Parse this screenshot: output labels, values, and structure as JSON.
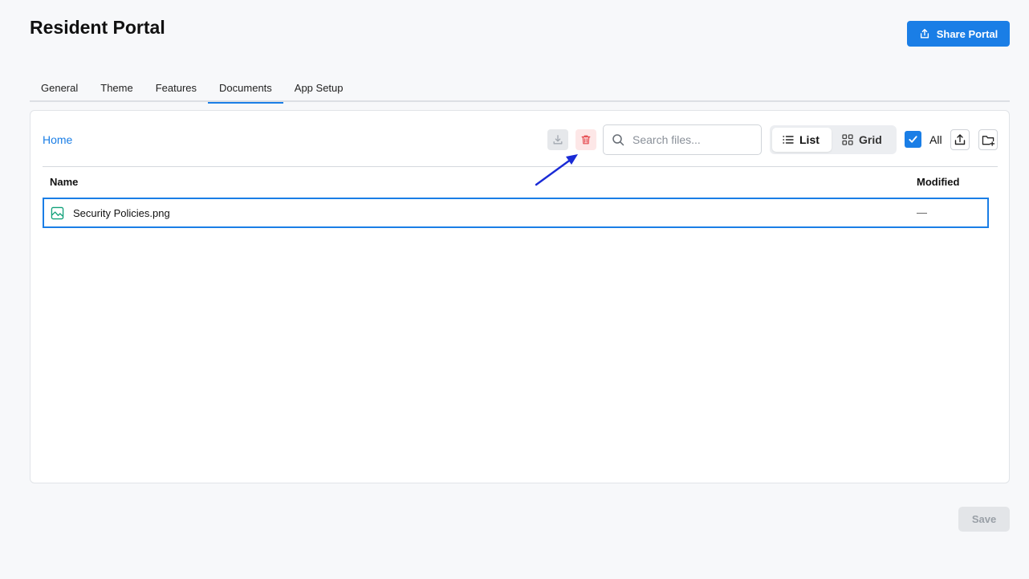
{
  "header": {
    "title": "Resident Portal",
    "share_label": "Share Portal"
  },
  "tabs": [
    {
      "label": "General",
      "active": false
    },
    {
      "label": "Theme",
      "active": false
    },
    {
      "label": "Features",
      "active": false
    },
    {
      "label": "Documents",
      "active": true
    },
    {
      "label": "App Setup",
      "active": false
    }
  ],
  "documents": {
    "breadcrumb": "Home",
    "search": {
      "placeholder": "Search files...",
      "value": ""
    },
    "view": {
      "list_label": "List",
      "grid_label": "Grid",
      "selected": "List"
    },
    "select_all_label": "All",
    "select_all_checked": true,
    "columns": {
      "name": "Name",
      "modified": "Modified"
    },
    "rows": [
      {
        "name": "Security Policies.png",
        "modified": "—",
        "icon": "image-file-icon",
        "selected": true
      }
    ]
  },
  "footer": {
    "save_label": "Save"
  },
  "colors": {
    "accent": "#1a7ee6",
    "delete_bg": "#fde7e7",
    "delete_icon": "#e5484d",
    "file_icon": "#12a17a",
    "annotation_arrow": "#1a2bd6"
  }
}
